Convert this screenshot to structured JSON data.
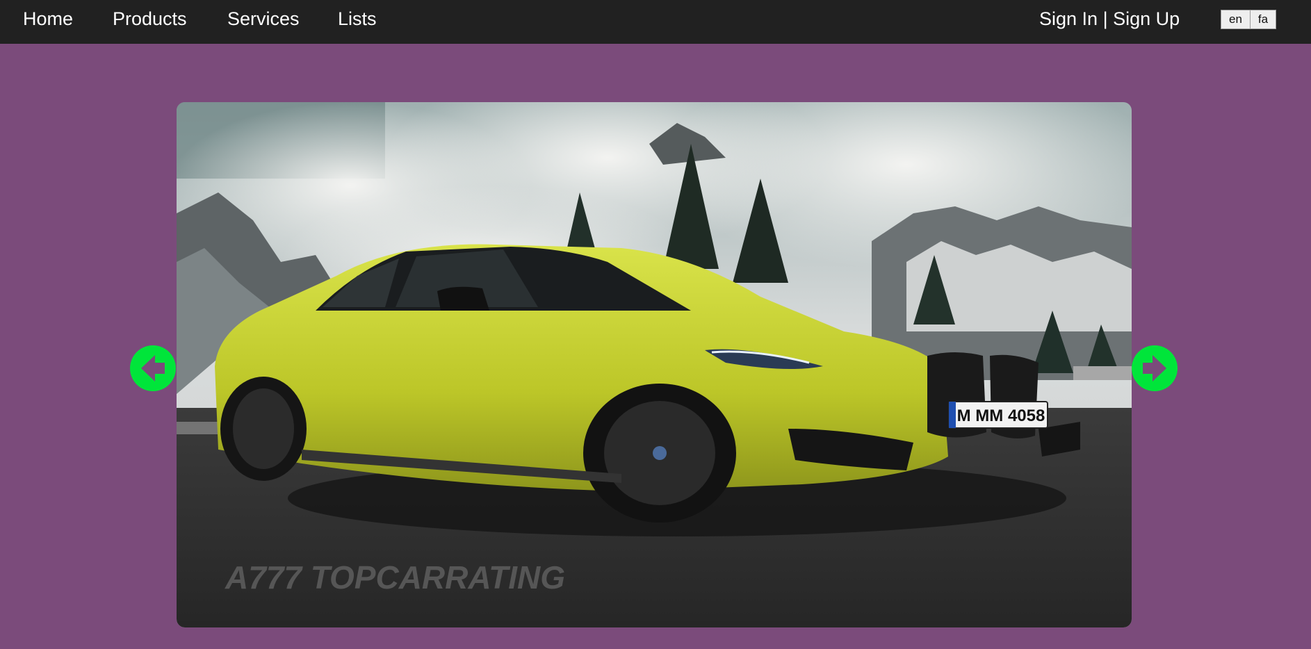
{
  "nav": {
    "home": "Home",
    "products": "Products",
    "services": "Services",
    "lists": "Lists",
    "sign_in": "Sign In",
    "separator": "|",
    "sign_up": "Sign Up",
    "lang_en": "en",
    "lang_fa": "fa"
  },
  "slider": {
    "plate_text": "M MM 4058",
    "watermark": "A777  TOPCARRATING",
    "prev_icon": "arrow-left-circle-icon",
    "next_icon": "arrow-right-circle-icon"
  },
  "colors": {
    "page_bg": "#7b4b7b",
    "navbar_bg": "#212121",
    "arrow_green": "#00e53a",
    "car_yellow": "#c4cf2e"
  }
}
